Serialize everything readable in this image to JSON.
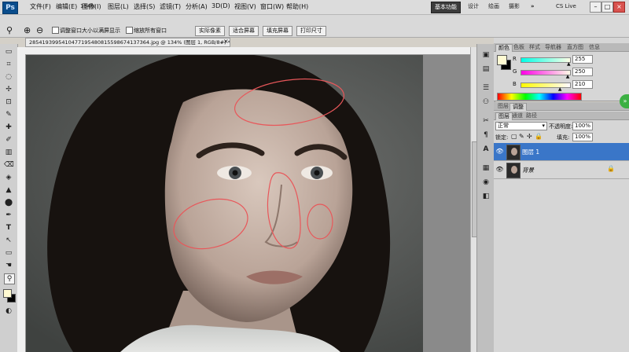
{
  "app": {
    "logo": "Ps"
  },
  "menubar": {
    "items": [
      "文件(F)",
      "编辑(E)",
      "图像(I)",
      "图层(L)",
      "选择(S)",
      "滤镜(T)",
      "分析(A)",
      "3D(D)",
      "视图(V)",
      "窗口(W)",
      "帮助(H)"
    ],
    "zoom": "134%",
    "workspaces": [
      "基本功能",
      "设计",
      "绘画",
      "摄影"
    ],
    "more": "»",
    "cslive": "CS Live",
    "win_controls": [
      "–",
      "□",
      "×"
    ]
  },
  "options": {
    "check1": "调整窗口大小以满屏显示",
    "check2": "缩放所有窗口",
    "buttons": [
      "实际像素",
      "适合屏幕",
      "填充屏幕",
      "打印尺寸"
    ]
  },
  "tools": [
    "▭",
    "⌗",
    "◌",
    "✢",
    "⊡",
    "✎",
    "✚",
    "✐",
    "▥",
    "⌫",
    "◈",
    "▲",
    "⬤",
    "✒",
    "T",
    "↖",
    "▭",
    "☚",
    "⚲",
    "◐"
  ],
  "document": {
    "tab_label": "2854193995410477195480815598674137364.jpg @ 134% (图层 1, RGB/8#) *",
    "close": "×"
  },
  "dock_icons": [
    "▣",
    "▤",
    "☰",
    "⚇",
    "✂",
    "¶",
    "A",
    "▦",
    "◉",
    "◧"
  ],
  "color_panel": {
    "tabs": [
      "颜色",
      "色板",
      "样式",
      "导航器",
      "直方图",
      "信息"
    ],
    "channels": [
      {
        "label": "R",
        "value": "255",
        "fill": 1.0,
        "gradient": "#00ffe6,#ffffe6"
      },
      {
        "label": "G",
        "value": "250",
        "fill": 0.98,
        "gradient": "#ff00e6,#fffae6"
      },
      {
        "label": "B",
        "value": "210",
        "fill": 0.82,
        "gradient": "#fffa00,#fffaff"
      }
    ],
    "fg_color": "#fffad2",
    "bg_color": "#000000"
  },
  "layers_panel": {
    "tabs": [
      "图层",
      "调整"
    ],
    "subtabs": [
      "图层",
      "通道",
      "路径"
    ],
    "blend_mode": "正常",
    "opacity_label": "不透明度:",
    "opacity_value": "100%",
    "lock_label": "锁定:",
    "fill_label": "填充:",
    "fill_value": "100%",
    "layers": [
      {
        "name": "图层 1",
        "selected": true
      },
      {
        "name": "背景",
        "selected": false,
        "locked": true
      }
    ]
  },
  "colors": {
    "accent_blue": "#2f6fc4",
    "selection_blue": "#3a76c8"
  }
}
